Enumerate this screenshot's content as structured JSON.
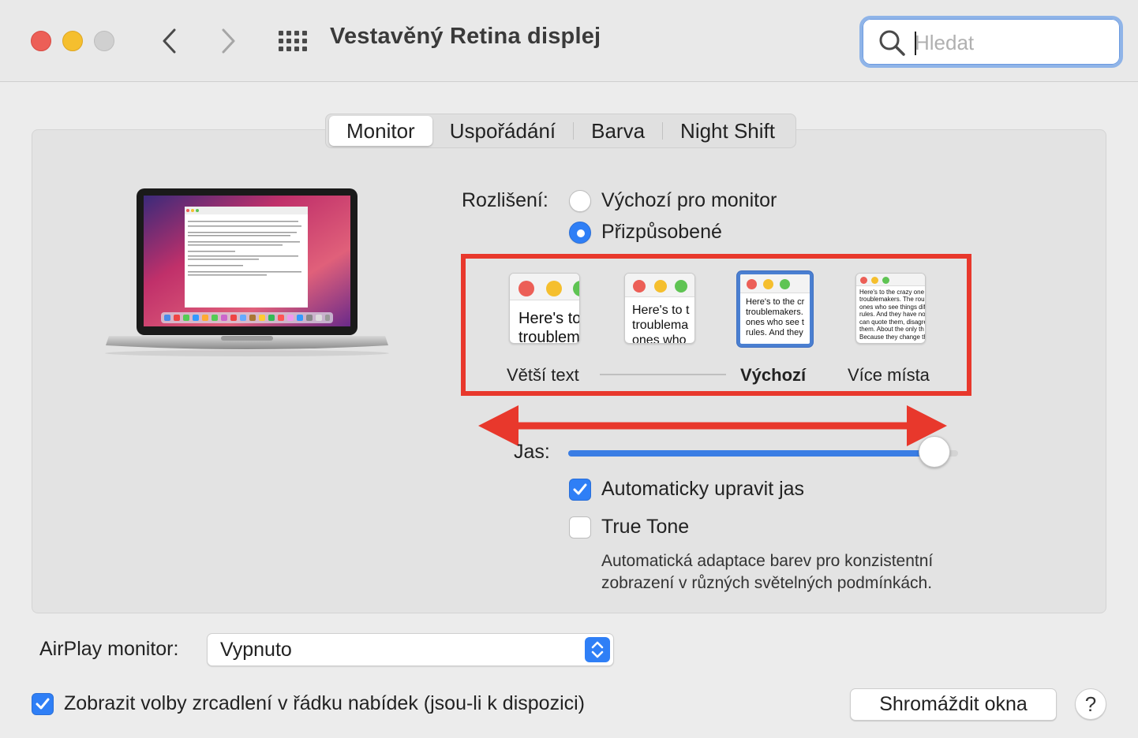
{
  "window": {
    "title": "Vestavěný Retina displej",
    "search_placeholder": "Hledat"
  },
  "tabs": [
    {
      "label": "Monitor",
      "active": true
    },
    {
      "label": "Uspořádání",
      "active": false
    },
    {
      "label": "Barva",
      "active": false
    },
    {
      "label": "Night Shift",
      "active": false
    }
  ],
  "resolution": {
    "label": "Rozlišení:",
    "options": [
      {
        "label": "Výchozí pro monitor",
        "selected": false
      },
      {
        "label": "Přizpůsobené",
        "selected": true
      }
    ],
    "scale_options": [
      {
        "label": "Větší text",
        "sample": "Here's to\ntroublem",
        "selected": false
      },
      {
        "label": "",
        "sample": "Here's to t\ntroublema\nones who",
        "selected": false
      },
      {
        "label": "Výchozí",
        "sample": "Here's to the cr\ntroublemakers.\nones who see t\nrules. And they",
        "selected": true
      },
      {
        "label": "Více místa",
        "sample": "Here's to the crazy one\ntroublemakers. The rou\nones who see things dif\nrules. And they have no\ncan quote them, disagre\nthem. About the only th\nBecause they change th",
        "selected": false
      }
    ]
  },
  "brightness": {
    "label": "Jas:",
    "value_fraction": 0.94
  },
  "auto_brightness": {
    "label": "Automaticky upravit jas",
    "checked": true
  },
  "true_tone": {
    "label": "True Tone",
    "checked": false,
    "description_line1": "Automatická adaptace barev pro konzistentní",
    "description_line2": "zobrazení v různých světelných podmínkách."
  },
  "airplay": {
    "label": "AirPlay monitor:",
    "value": "Vypnuto"
  },
  "mirroring": {
    "label": "Zobrazit volby zrcadlení v řádku nabídek (jsou-li k dispozici)",
    "checked": true
  },
  "gather_button": "Shromáždit okna",
  "help_button": "?",
  "colors": {
    "accent": "#2f7ff6",
    "annotation_red": "#e8382c",
    "close": "#ec5f57",
    "minimize": "#f5bf2e"
  }
}
